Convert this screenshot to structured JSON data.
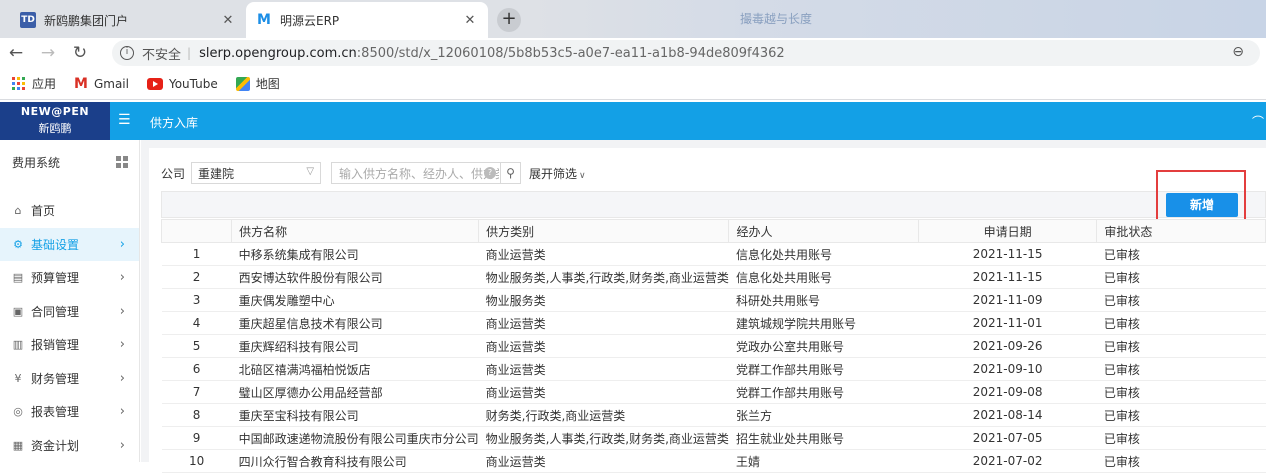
{
  "browser": {
    "tabs": [
      {
        "title": "新鸥鹏集团门户",
        "favicon": "TD",
        "active": false
      },
      {
        "title": "明源云ERP",
        "favicon": "M",
        "active": true
      }
    ],
    "new_tab": "+",
    "address": {
      "security": "不安全",
      "host": "slerp.opengroup.com.cn",
      "path": ":8500/std/x_12060108/5b8b53c5-a0e7-ea11-a1b8-94de809f4362"
    },
    "watermark": "撮毒越与长度",
    "bookmarks": [
      {
        "label": "应用",
        "icon": "apps-icon"
      },
      {
        "label": "Gmail",
        "icon": "gmail-icon"
      },
      {
        "label": "YouTube",
        "icon": "youtube-icon"
      },
      {
        "label": "地图",
        "icon": "maps-icon"
      }
    ]
  },
  "header": {
    "logo_line1": "NEW@PEN",
    "logo_line2": "新鸥鹏",
    "title": "供方入库",
    "accent": "#13a0e6"
  },
  "sidebar": {
    "system": "费用系统",
    "items": [
      {
        "label": "首页",
        "icon": "⌂",
        "chevron": false,
        "active": false
      },
      {
        "label": "基础设置",
        "icon": "⚙",
        "chevron": true,
        "active": true
      },
      {
        "label": "预算管理",
        "icon": "▤",
        "chevron": true,
        "active": false
      },
      {
        "label": "合同管理",
        "icon": "▣",
        "chevron": true,
        "active": false
      },
      {
        "label": "报销管理",
        "icon": "▥",
        "chevron": true,
        "active": false
      },
      {
        "label": "财务管理",
        "icon": "¥",
        "chevron": true,
        "active": false
      },
      {
        "label": "报表管理",
        "icon": "◎",
        "chevron": true,
        "active": false
      },
      {
        "label": "资金计划",
        "icon": "▦",
        "chevron": true,
        "active": false
      }
    ]
  },
  "filter": {
    "company_label": "公司",
    "company_value": "重建院",
    "search_placeholder": "输入供方名称、经办人、供方类别",
    "expand_label": "展开筛选"
  },
  "toolbar": {
    "add_label": "新增"
  },
  "table": {
    "columns": [
      "",
      "供方名称",
      "供方类别",
      "经办人",
      "申请日期",
      "审批状态"
    ],
    "rows": [
      [
        "1",
        "中移系统集成有限公司",
        "商业运营类",
        "信息化处共用账号",
        "2021-11-15",
        "已审核"
      ],
      [
        "2",
        "西安博达软件股份有限公司",
        "物业服务类,人事类,行政类,财务类,商业运营类",
        "信息化处共用账号",
        "2021-11-15",
        "已审核"
      ],
      [
        "3",
        "重庆偶发雕塑中心",
        "物业服务类",
        "科研处共用账号",
        "2021-11-09",
        "已审核"
      ],
      [
        "4",
        "重庆超星信息技术有限公司",
        "商业运营类",
        "建筑城规学院共用账号",
        "2021-11-01",
        "已审核"
      ],
      [
        "5",
        "重庆辉绍科技有限公司",
        "商业运营类",
        "党政办公室共用账号",
        "2021-09-26",
        "已审核"
      ],
      [
        "6",
        "北碚区禧满鸿福柏悦饭店",
        "商业运营类",
        "党群工作部共用账号",
        "2021-09-10",
        "已审核"
      ],
      [
        "7",
        "璧山区厚德办公用品经营部",
        "商业运营类",
        "党群工作部共用账号",
        "2021-09-08",
        "已审核"
      ],
      [
        "8",
        "重庆至宝科技有限公司",
        "财务类,行政类,商业运营类",
        "张兰方",
        "2021-08-14",
        "已审核"
      ],
      [
        "9",
        "中国邮政速递物流股份有限公司重庆市分公司",
        "物业服务类,人事类,行政类,财务类,商业运营类",
        "招生就业处共用账号",
        "2021-07-05",
        "已审核"
      ],
      [
        "10",
        "四川众行智合教育科技有限公司",
        "商业运营类",
        "王婧",
        "2021-07-02",
        "已审核"
      ]
    ]
  }
}
